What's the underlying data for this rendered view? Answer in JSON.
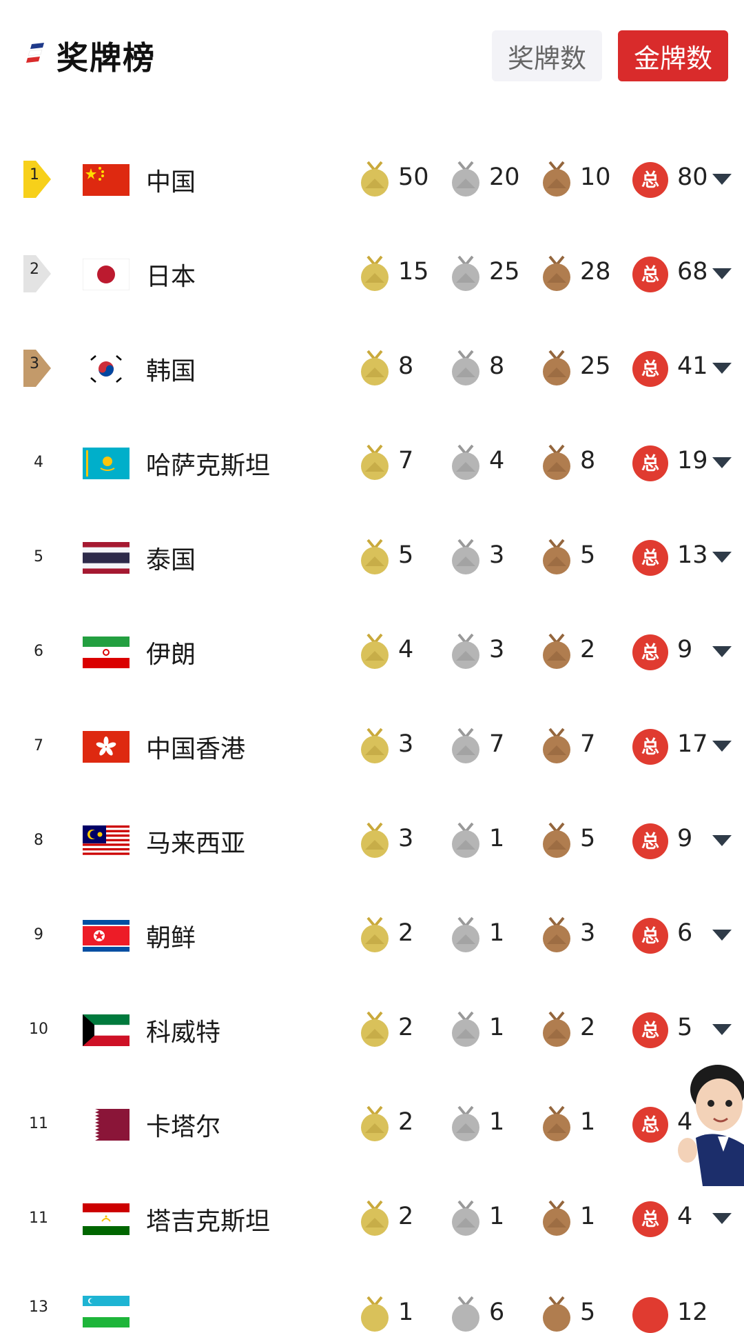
{
  "header": {
    "title": "奖牌榜",
    "tab_medals": "奖牌数",
    "tab_gold": "金牌数",
    "total_badge_label": "总"
  },
  "colors": {
    "accent_red": "#d92b2b",
    "gold_medal": "#d9c15a",
    "silver_medal": "#b5b5b5",
    "bronze_medal": "#b07d4f",
    "rank1": "#f7d01a",
    "rank2": "#e3e3e3",
    "rank3": "#c39a6a"
  },
  "rows": [
    {
      "rank": "1",
      "country": "中国",
      "gold": "50",
      "silver": "20",
      "bronze": "10",
      "total": "80"
    },
    {
      "rank": "2",
      "country": "日本",
      "gold": "15",
      "silver": "25",
      "bronze": "28",
      "total": "68"
    },
    {
      "rank": "3",
      "country": "韩国",
      "gold": "8",
      "silver": "8",
      "bronze": "25",
      "total": "41"
    },
    {
      "rank": "4",
      "country": "哈萨克斯坦",
      "gold": "7",
      "silver": "4",
      "bronze": "8",
      "total": "19"
    },
    {
      "rank": "5",
      "country": "泰国",
      "gold": "5",
      "silver": "3",
      "bronze": "5",
      "total": "13"
    },
    {
      "rank": "6",
      "country": "伊朗",
      "gold": "4",
      "silver": "3",
      "bronze": "2",
      "total": "9"
    },
    {
      "rank": "7",
      "country": "中国香港",
      "gold": "3",
      "silver": "7",
      "bronze": "7",
      "total": "17"
    },
    {
      "rank": "8",
      "country": "马来西亚",
      "gold": "3",
      "silver": "1",
      "bronze": "5",
      "total": "9"
    },
    {
      "rank": "9",
      "country": "朝鲜",
      "gold": "2",
      "silver": "1",
      "bronze": "3",
      "total": "6"
    },
    {
      "rank": "10",
      "country": "科威特",
      "gold": "2",
      "silver": "1",
      "bronze": "2",
      "total": "5"
    },
    {
      "rank": "11",
      "country": "卡塔尔",
      "gold": "2",
      "silver": "1",
      "bronze": "1",
      "total": "4"
    },
    {
      "rank": "11",
      "country": "塔吉克斯坦",
      "gold": "2",
      "silver": "1",
      "bronze": "1",
      "total": "4"
    },
    {
      "rank": "13",
      "country": "",
      "gold": "1",
      "silver": "6",
      "bronze": "5",
      "total": "12"
    }
  ]
}
